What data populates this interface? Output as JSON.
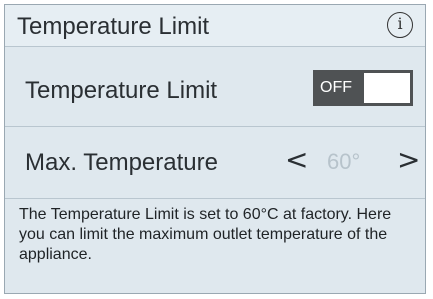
{
  "header": {
    "title": "Temperature Limit",
    "info_icon": "info-icon"
  },
  "setting_toggle": {
    "label": "Temperature Limit",
    "state_text": "OFF",
    "on": false
  },
  "max_temperature": {
    "label": "Max. Temperature",
    "value": "60°",
    "decrease_symbol": "<",
    "increase_symbol": ">",
    "enabled": false
  },
  "description": "The Temperature Limit is set to 60°C at factory. Here you can limit the maximum outlet temperature of the appliance.",
  "colors": {
    "panel_bg": "#dfe8ee",
    "toggle_off_bg": "#4f5254",
    "disabled_value": "#b7c3cb"
  }
}
